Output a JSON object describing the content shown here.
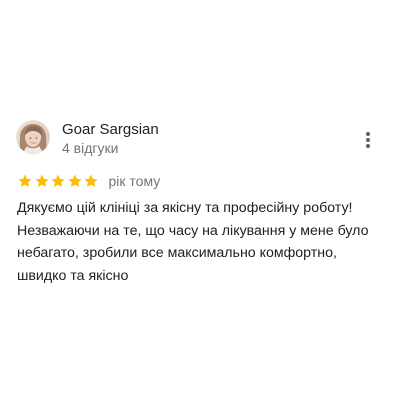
{
  "review": {
    "author_name": "Goar Sargsian",
    "author_meta": "4 відгуки",
    "rating": 5,
    "rating_max": 5,
    "date": "рік тому",
    "text": "Дякуємо цій клініці за якісну та професійну роботу!\nНезважаючи на те, що часу на лікування у мене було\nнебагато, зробили все максимально комфортно,\nшвидко та якісно"
  },
  "colors": {
    "star": "#fbbc04",
    "name": "#202124",
    "meta": "#70757a",
    "text": "#202124",
    "menu_dots": "#5f6368"
  },
  "icons": {
    "avatar": "user-photo",
    "menu": "more-vertical-icon",
    "star": "star-icon"
  }
}
